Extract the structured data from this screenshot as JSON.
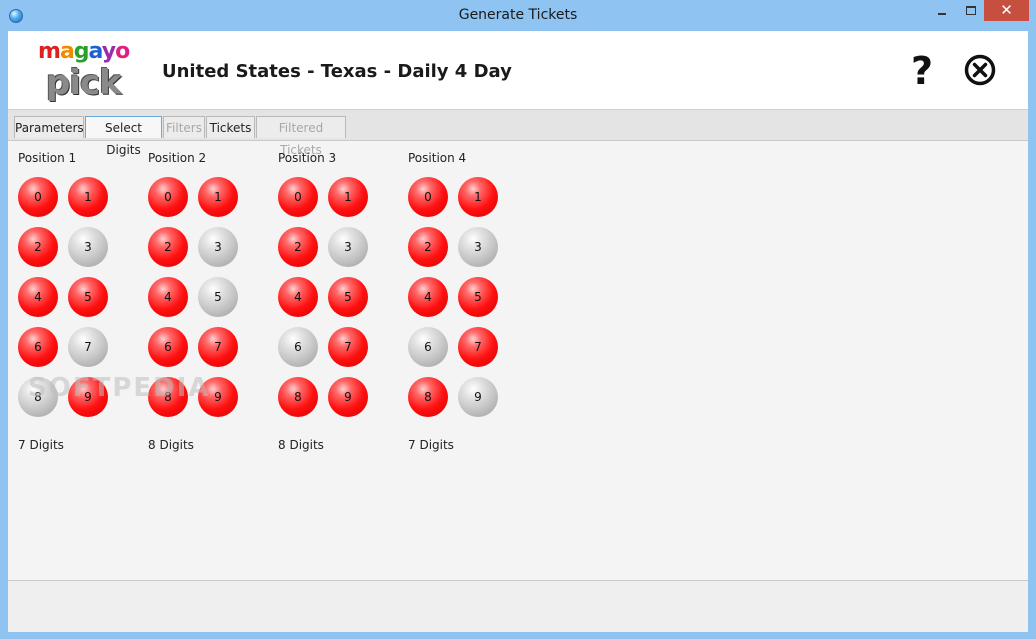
{
  "window": {
    "title": "Generate Tickets"
  },
  "header": {
    "logo_top": "magayo",
    "logo_bottom": "pick",
    "logo_colors": [
      "#e02020",
      "#f08a00",
      "#2aa02a",
      "#1f5fd0",
      "#9a2ab0",
      "#e02080"
    ],
    "title": "United States - Texas - Daily 4 Day",
    "help_glyph": "?",
    "help_icon": "question-mark-icon",
    "close_icon": "close-circle-icon"
  },
  "tabs": [
    {
      "label": "Parameters",
      "state": "normal"
    },
    {
      "label": "Select Digits",
      "state": "active"
    },
    {
      "label": "Filters",
      "state": "disabled"
    },
    {
      "label": "Tickets",
      "state": "normal"
    },
    {
      "label": "Filtered Tickets",
      "state": "disabled"
    }
  ],
  "positions": [
    {
      "label": "Position 1",
      "selected": [
        true,
        true,
        true,
        false,
        true,
        true,
        true,
        false,
        false,
        true
      ],
      "count_label": "7 Digits"
    },
    {
      "label": "Position 2",
      "selected": [
        true,
        true,
        true,
        false,
        true,
        false,
        true,
        true,
        true,
        true
      ],
      "count_label": "8 Digits"
    },
    {
      "label": "Position 3",
      "selected": [
        true,
        true,
        true,
        false,
        true,
        true,
        false,
        true,
        true,
        true
      ],
      "count_label": "8 Digits"
    },
    {
      "label": "Position 4",
      "selected": [
        true,
        true,
        true,
        false,
        true,
        true,
        false,
        true,
        true,
        false
      ],
      "count_label": "7 Digits"
    }
  ],
  "digits": [
    "0",
    "1",
    "2",
    "3",
    "4",
    "5",
    "6",
    "7",
    "8",
    "9"
  ],
  "colors": {
    "selected": "#ff1a1a",
    "unselected": "#c0c0c0",
    "accent": "#6aa7d6"
  },
  "watermark": "SOFTPEDIA"
}
